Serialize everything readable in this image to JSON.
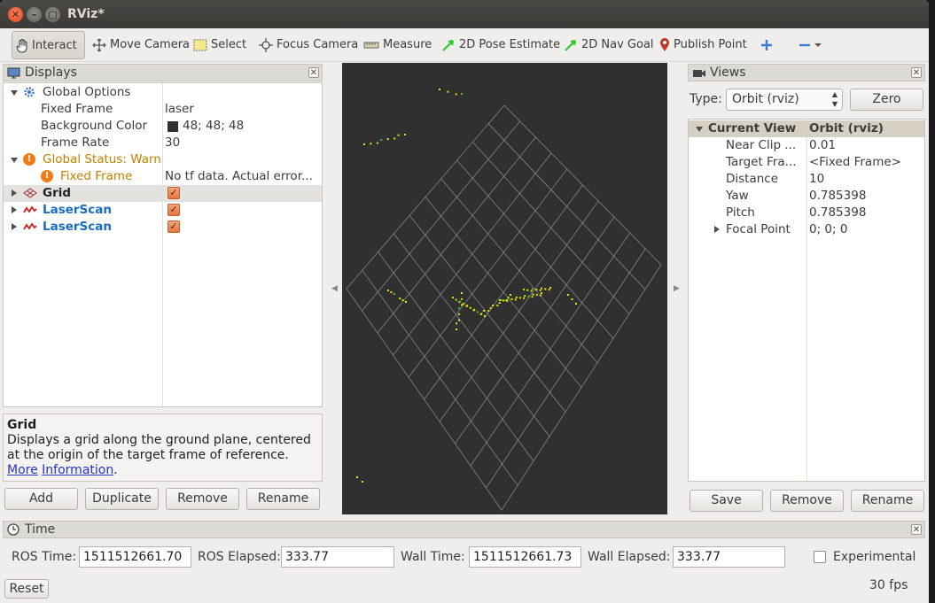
{
  "window": {
    "title": "RViz*"
  },
  "toolbar": {
    "interact": "Interact",
    "move_camera": "Move Camera",
    "select": "Select",
    "focus_camera": "Focus Camera",
    "measure": "Measure",
    "pose_estimate": "2D Pose Estimate",
    "nav_goal": "2D Nav Goal",
    "publish_point": "Publish Point"
  },
  "displays": {
    "title": "Displays",
    "global_options": {
      "label": "Global Options",
      "fixed_frame_label": "Fixed Frame",
      "fixed_frame_value": "laser",
      "bg_color_label": "Background Color",
      "bg_color_value": "48; 48; 48",
      "frame_rate_label": "Frame Rate",
      "frame_rate_value": "30"
    },
    "global_status": {
      "label": "Global Status: Warn",
      "fixed_frame_label": "Fixed Frame",
      "fixed_frame_value": "No tf data.  Actual error..."
    },
    "items": [
      {
        "label": "Grid",
        "checked": true
      },
      {
        "label": "LaserScan",
        "checked": true
      },
      {
        "label": "LaserScan",
        "checked": true
      }
    ],
    "description": {
      "title": "Grid",
      "text": "Displays a grid along the ground plane, centered at the origin of the target frame of reference.",
      "link_text_1": "More",
      "link_text_2": "Information",
      "suffix": "."
    },
    "buttons": {
      "add": "Add",
      "duplicate": "Duplicate",
      "remove": "Remove",
      "rename": "Rename"
    }
  },
  "views": {
    "title": "Views",
    "type_label": "Type:",
    "type_value": "Orbit (rviz)",
    "zero_button": "Zero",
    "current_view_label": "Current View",
    "current_view_value": "Orbit (rviz)",
    "props": [
      {
        "label": "Near Clip ...",
        "value": "0.01"
      },
      {
        "label": "Target Fra...",
        "value": "<Fixed Frame>"
      },
      {
        "label": "Distance",
        "value": "10"
      },
      {
        "label": "Yaw",
        "value": "0.785398"
      },
      {
        "label": "Pitch",
        "value": "0.785398"
      },
      {
        "label": "Focal Point",
        "value": "0; 0; 0"
      }
    ],
    "buttons": {
      "save": "Save",
      "remove": "Remove",
      "rename": "Rename"
    }
  },
  "time": {
    "title": "Time",
    "ros_time_label": "ROS Time:",
    "ros_time_value": "1511512661.70",
    "ros_elapsed_label": "ROS Elapsed:",
    "ros_elapsed_value": "333.77",
    "wall_time_label": "Wall Time:",
    "wall_time_value": "1511512661.73",
    "wall_elapsed_label": "Wall Elapsed:",
    "wall_elapsed_value": "333.77",
    "experimental_label": "Experimental",
    "experimental_checked": false,
    "reset_button": "Reset",
    "fps": "30 fps"
  },
  "colors": {
    "background": "#303030",
    "grid_line": "#a0a0a0",
    "laser_yellow": "#e6e600",
    "laser_green": "#40c040",
    "warn": "#f07d1a",
    "link_blue": "#1a6cc0"
  }
}
